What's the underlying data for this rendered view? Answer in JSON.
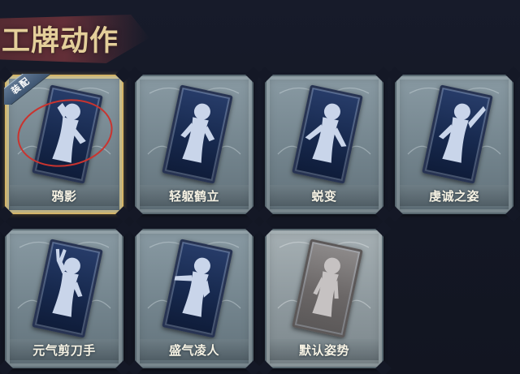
{
  "header": {
    "title": "工牌动作"
  },
  "colors": {
    "background": "#141826",
    "title": "#e4cf9a",
    "title_ribbon": "#6b3139",
    "frame": "#7a8b94",
    "equipped_border": "#d4b568",
    "card_back": "#17294e",
    "highlight_circle": "#c9342f",
    "badge": "#50667f"
  },
  "cards": [
    {
      "label": "鸦影",
      "badge": "装配",
      "state": "equipped",
      "icon": "salute-pose-figure-icon"
    },
    {
      "label": "轻躯鹤立",
      "state": "available",
      "icon": "crane-stance-figure-icon"
    },
    {
      "label": "蜕变",
      "state": "available",
      "icon": "spread-arms-figure-icon"
    },
    {
      "label": "虔诚之姿",
      "state": "available",
      "icon": "raised-hand-figure-icon"
    },
    {
      "label": "元气剪刀手",
      "state": "available",
      "icon": "peace-sign-figure-icon"
    },
    {
      "label": "盛气凌人",
      "state": "available",
      "icon": "pointing-figure-icon"
    },
    {
      "label": "默认姿势",
      "state": "default",
      "icon": "default-pose-figure-icon"
    }
  ]
}
